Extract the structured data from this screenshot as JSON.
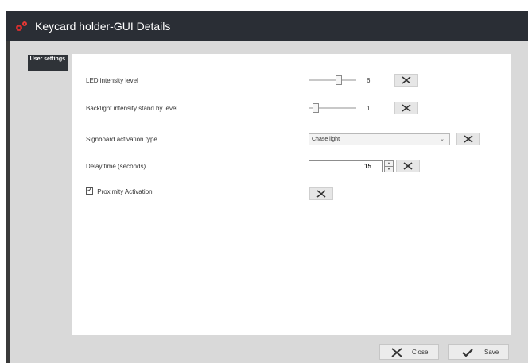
{
  "window": {
    "title": "Keycard holder-GUI Details",
    "accent_color": "#d32f2f"
  },
  "sidebar": {
    "tab_label": "User settings"
  },
  "settings": {
    "led_intensity": {
      "label": "LED intensity level",
      "value": "6"
    },
    "backlight_intensity": {
      "label": "Backlight intensity stand by level",
      "value": "1"
    },
    "signboard_activation": {
      "label": "Signboard activation type",
      "selected": "Chase light"
    },
    "delay_time": {
      "label": "Delay time (seconds)",
      "value": "15"
    },
    "proximity": {
      "label": "Proximity Activation",
      "checked": true
    }
  },
  "footer": {
    "close_label": "Close",
    "save_label": "Save"
  },
  "icons": {
    "clear": "clear-icon",
    "close": "close-icon",
    "save": "checkmark-icon",
    "app": "gears-icon"
  }
}
